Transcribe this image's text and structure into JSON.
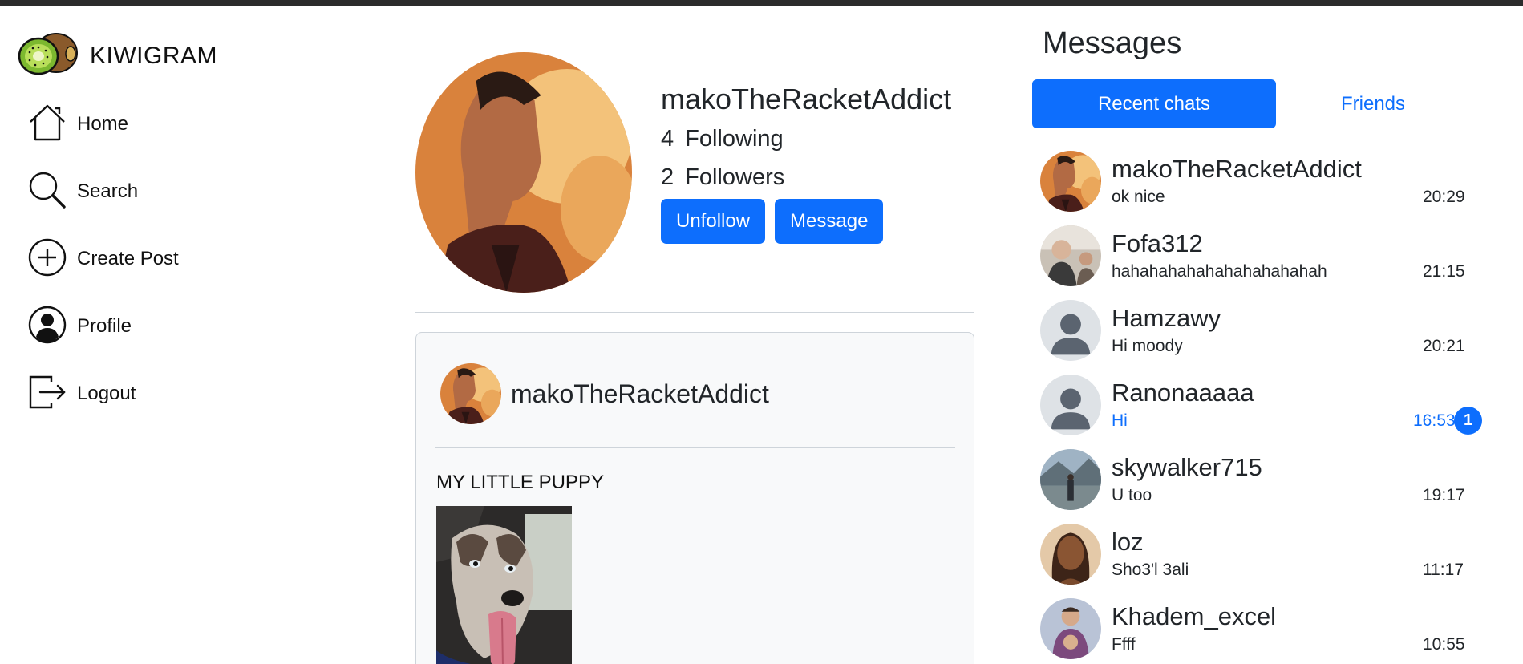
{
  "brand": {
    "name": "KIWIGRAM",
    "logo": "kiwi-logo"
  },
  "nav": {
    "items": [
      {
        "label": "Home",
        "icon": "home-icon"
      },
      {
        "label": "Search",
        "icon": "search-icon"
      },
      {
        "label": "Create Post",
        "icon": "plus-circle-icon"
      },
      {
        "label": "Profile",
        "icon": "user-circle-icon"
      },
      {
        "label": "Logout",
        "icon": "logout-icon"
      }
    ]
  },
  "profile": {
    "username": "makoTheRacketAddict",
    "following_count": "4",
    "following_label": "Following",
    "followers_count": "2",
    "followers_label": "Followers",
    "unfollow_label": "Unfollow",
    "message_label": "Message"
  },
  "post": {
    "author": "makoTheRacketAddict",
    "caption": "MY LITTLE PUPPY"
  },
  "messages": {
    "title": "Messages",
    "tabs": [
      {
        "label": "Recent chats",
        "active": true
      },
      {
        "label": "Friends",
        "active": false
      }
    ],
    "chats": [
      {
        "name": "makoTheRacketAddict",
        "preview": "ok nice",
        "time": "20:29"
      },
      {
        "name": "Fofa312",
        "preview": "hahahahahahahahahahahah",
        "time": "21:15"
      },
      {
        "name": "Hamzawy",
        "preview": "Hi moody",
        "time": "20:21"
      },
      {
        "name": "Ranonaaaaa",
        "preview": "Hi",
        "time": "16:53",
        "unread": "1"
      },
      {
        "name": "skywalker715",
        "preview": "U too",
        "time": "19:17"
      },
      {
        "name": "loz",
        "preview": "Sho3'l 3ali",
        "time": "11:17"
      },
      {
        "name": "Khadem_excel",
        "preview": "Ffff",
        "time": "10:55"
      }
    ]
  },
  "colors": {
    "accent": "#0d6efd",
    "text": "#212529",
    "card_bg": "#f8f9fa",
    "border": "#ced4da"
  }
}
